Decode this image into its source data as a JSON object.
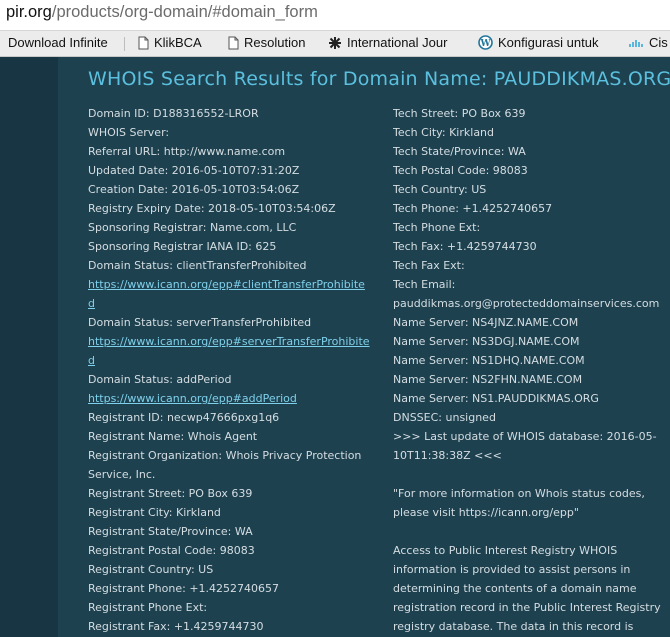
{
  "browser": {
    "url_host": "pir.org",
    "url_path": "/products/org-domain/#domain_form",
    "bookmarks": [
      {
        "label": "Download Infinite",
        "icon": "page-icon"
      },
      {
        "label": "KlikBCA",
        "icon": "page-icon"
      },
      {
        "label": "Resolution",
        "icon": "page-icon"
      },
      {
        "label": "International Jour",
        "icon": "favicon-icon"
      },
      {
        "label": "Konfigurasi untuk",
        "icon": "wordpress-icon"
      },
      {
        "label": "Cis",
        "icon": "cisco-icon"
      }
    ]
  },
  "whois": {
    "title": "WHOIS Search Results for Domain Name: PAUDDIKMAS.ORG",
    "left": [
      "Domain ID: D188316552-LROR",
      "WHOIS Server:",
      "Referral URL: http://www.name.com",
      "Updated Date: 2016-05-10T07:31:20Z",
      "Creation Date: 2016-05-10T03:54:06Z",
      "Registry Expiry Date: 2018-05-10T03:54:06Z",
      "Sponsoring Registrar: Name.com, LLC",
      "Sponsoring Registrar IANA ID: 625",
      "Domain Status: clientTransferProhibited",
      "https://www.icann.org/epp#clientTransferProhibite",
      "d",
      "Domain Status: serverTransferProhibited",
      "https://www.icann.org/epp#serverTransferProhibite",
      "d",
      "Domain Status: addPeriod",
      "https://www.icann.org/epp#addPeriod",
      "Registrant ID: necwp47666pxg1q6",
      "Registrant Name: Whois Agent",
      "Registrant Organization: Whois Privacy Protection",
      "Service, Inc.",
      "Registrant Street: PO Box 639",
      "Registrant City: Kirkland",
      "Registrant State/Province: WA",
      "Registrant Postal Code: 98083",
      "Registrant Country: US",
      "Registrant Phone: +1.4252740657",
      "Registrant Phone Ext:",
      "Registrant Fax: +1.4259744730"
    ],
    "right": [
      "Tech Street: PO Box 639",
      "Tech City: Kirkland",
      "Tech State/Province: WA",
      "Tech Postal Code: 98083",
      "Tech Country: US",
      "Tech Phone: +1.4252740657",
      "Tech Phone Ext:",
      "Tech Fax: +1.4259744730",
      "Tech Fax Ext:",
      "Tech Email:",
      "pauddikmas.org@protecteddomainservices.com",
      "Name Server: NS4JNZ.NAME.COM",
      "Name Server: NS3DGJ.NAME.COM",
      "Name Server: NS1DHQ.NAME.COM",
      "Name Server: NS2FHN.NAME.COM",
      "Name Server: NS1.PAUDDIKMAS.ORG",
      "DNSSEC: unsigned",
      ">>> Last update of WHOIS database: 2016-05-",
      "10T11:38:38Z <<<",
      "",
      "\"For more information on Whois status codes,",
      "please visit https://icann.org/epp\"",
      "",
      "Access to Public Interest Registry WHOIS",
      "information is provided to assist persons in",
      "determining the contents of a domain name",
      "registration record in the Public Interest Registry",
      "registry database. The data in this record is"
    ],
    "link_rows_left": [
      9,
      10,
      12,
      13,
      15
    ]
  }
}
